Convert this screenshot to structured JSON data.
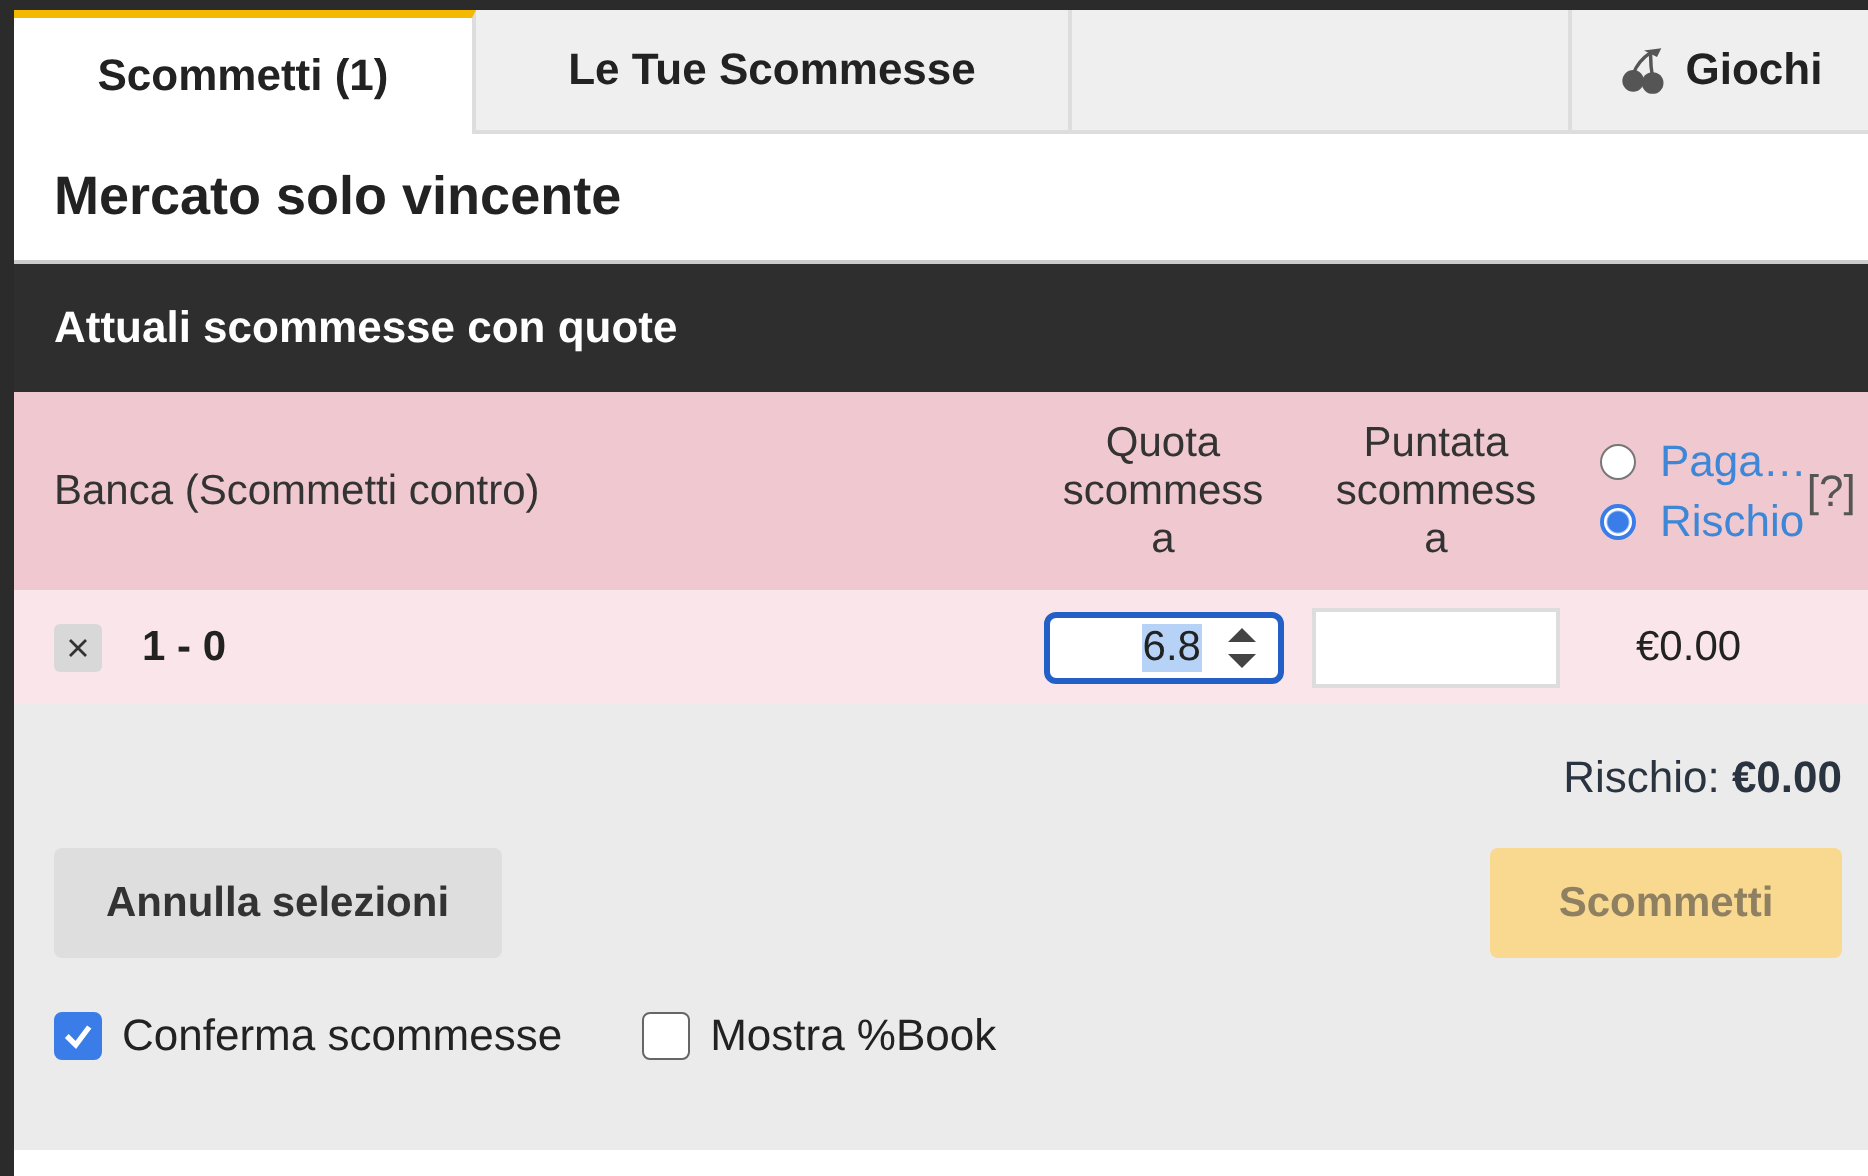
{
  "tabs": [
    {
      "label": "Scommetti (1)",
      "selected": true
    },
    {
      "label": "Le Tue Scommesse",
      "selected": false
    },
    {
      "label": "Giochi",
      "selected": false,
      "kind": "games"
    }
  ],
  "market_title": "Mercato solo vincente",
  "section_title": "Attuali scommesse con quote",
  "header": {
    "side": "Banca (Scommetti contro)",
    "odds": "Quota scommess a",
    "stake": "Puntata scommess a",
    "options": [
      {
        "label": "Paga…",
        "selected": false
      },
      {
        "label": "Rischio",
        "selected": true
      }
    ],
    "help": "[?]"
  },
  "bets": [
    {
      "selection": "1 - 0",
      "odds": "6.8",
      "liability": "€0.00"
    }
  ],
  "total": {
    "label": "Rischio:",
    "value": "€0.00"
  },
  "buttons": [
    {
      "label": "Annulla selezioni",
      "disabled": false
    },
    {
      "label": "Scommetti",
      "disabled": true
    }
  ],
  "checkboxes": [
    {
      "label": "Conferma scommesse",
      "checked": true
    },
    {
      "label": "Mostra %Book",
      "checked": false
    }
  ]
}
